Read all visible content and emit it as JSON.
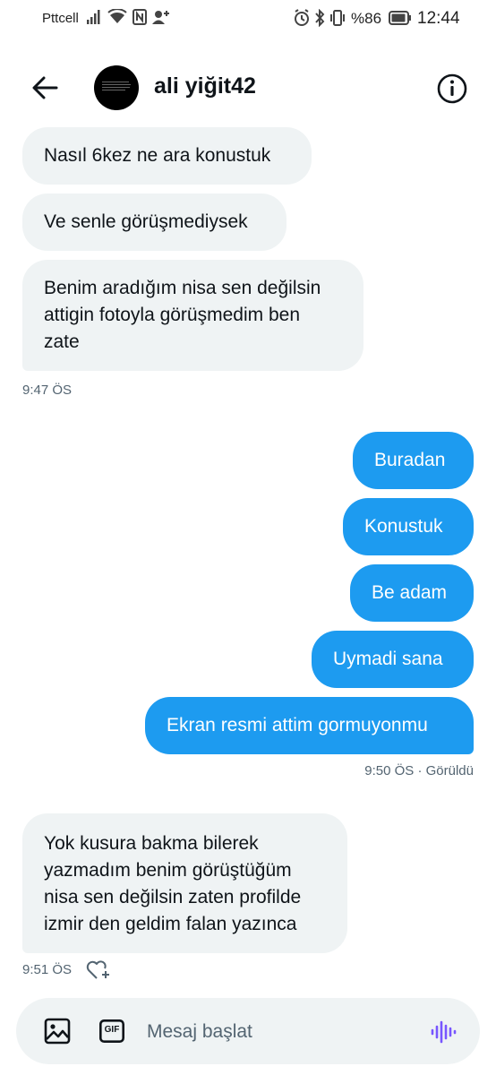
{
  "status_bar": {
    "carrier": "Pttcell",
    "battery": "%86",
    "time": "12:44"
  },
  "header": {
    "contact_name": "ali yiğit42",
    "back_icon": "arrow-left-icon",
    "info_icon": "info-icon"
  },
  "messages": {
    "in1": "Nasıl 6kez ne ara konustuk",
    "in2": "Ve senle görüşmediysek",
    "in3": "Benim aradığım nisa sen değilsin\nattigin fotoyla görüşmedim ben\nzate",
    "time1": "9:47 ÖS",
    "out1": "Buradan",
    "out2": "Konustuk",
    "out3": "Be adam",
    "out4": "Uymadi sana",
    "out5": "Ekran resmi attim gormuyonmu",
    "time2": "9:50 ÖS · Görüldü",
    "in4": "Yok  kusura bakma bilerek\nyazmadım benim görüştüğüm\nnisa sen değilsin zaten profilde\nizmir den geldim falan yazınca",
    "time3": "9:51 ÖS"
  },
  "composer": {
    "placeholder": "Mesaj başlat",
    "gif_label": "GIF"
  },
  "colors": {
    "accent": "#1d9bf0",
    "incoming_bubble": "#eff3f4",
    "voice_icon": "#7856ff",
    "meta_text": "#536471"
  }
}
